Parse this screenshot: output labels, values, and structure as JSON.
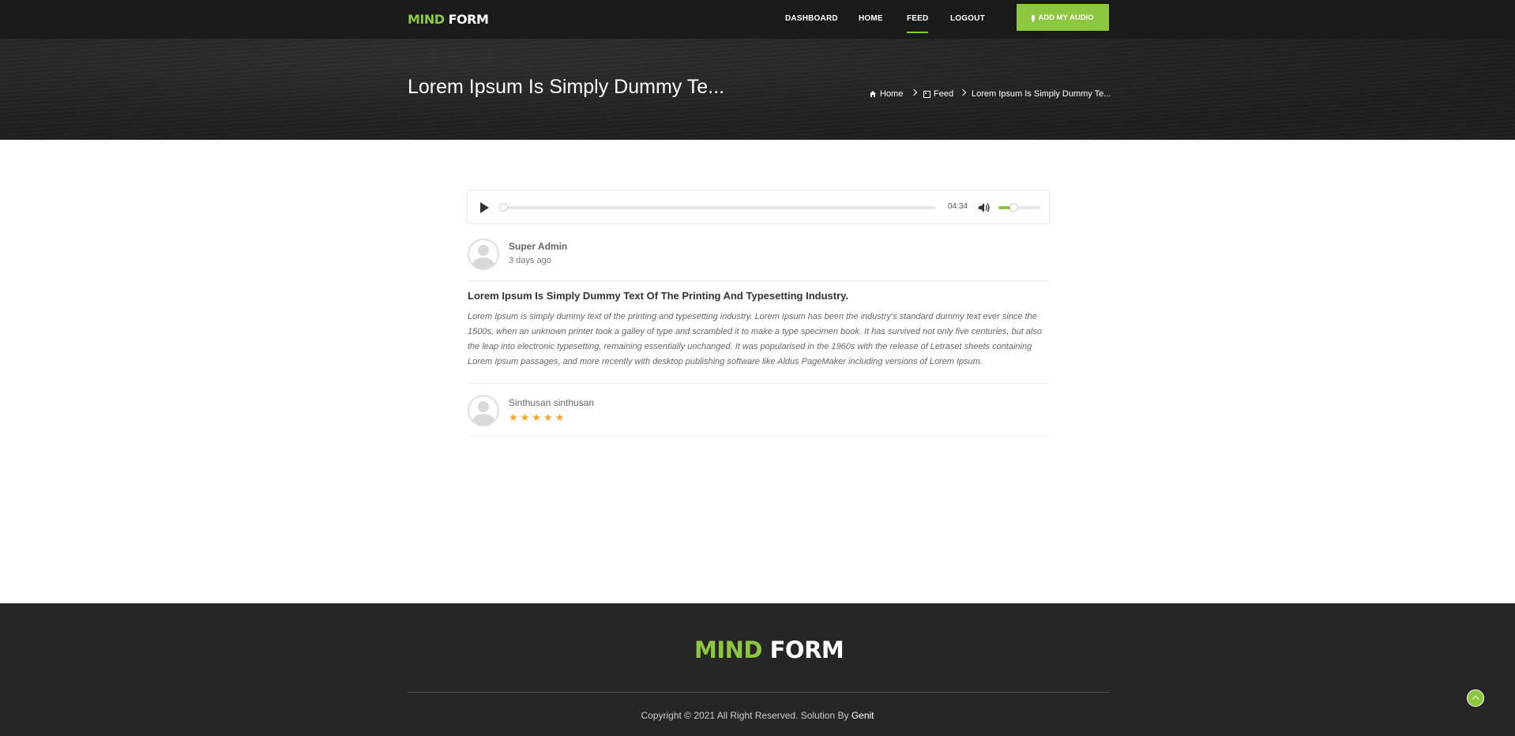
{
  "header": {
    "logo": {
      "part1": "MIND",
      "part2": "FORM"
    },
    "nav": [
      {
        "label": "DASHBOARD"
      },
      {
        "label": "HOME"
      },
      {
        "label": "FEED",
        "active": true
      },
      {
        "label": "LOGOUT"
      }
    ],
    "add_audio_label": "ADD MY AUDIO",
    "add_audio_icon": "microphone-icon"
  },
  "banner": {
    "title": "Lorem Ipsum Is Simply Dummy Te...",
    "breadcrumb": [
      {
        "icon": "home-icon",
        "label": "Home"
      },
      {
        "icon": "rss-icon",
        "label": "Feed"
      },
      {
        "icon": "",
        "label": "Lorem Ipsum Is Simply Dummy Te..."
      }
    ]
  },
  "player": {
    "duration": "04:34",
    "progress_fraction": 0,
    "volume_fraction": 0.35
  },
  "post": {
    "author": "Super Admin",
    "time": "3 days ago",
    "title": "Lorem Ipsum Is Simply Dummy Text Of The Printing And Typesetting Industry.",
    "body": "Lorem Ipsum is simply dummy text of the printing and typesetting industry. Lorem Ipsum has been the industry's standard dummy text ever since the 1500s, when an unknown printer took a galley of type and scrambled it to make a type specimen book. It has survived not only five centuries, but also the leap into electronic typesetting, remaining essentially unchanged. It was popularised in the 1960s with the release of Letraset sheets containing Lorem Ipsum passages, and more recently with desktop publishing software like Aldus PageMaker including versions of Lorem Ipsum."
  },
  "review": {
    "name": "Sinthusan sinthusan",
    "rating": 5,
    "max_rating": 5
  },
  "footer": {
    "logo": {
      "part1": "MIND",
      "part2": "FORM"
    },
    "copyright": "Copyright © 2021 All Right Reserved. Solution By",
    "brand": "Genit"
  },
  "colors": {
    "accent": "#8dc63f",
    "star": "#f5a623",
    "dark": "#262626"
  }
}
